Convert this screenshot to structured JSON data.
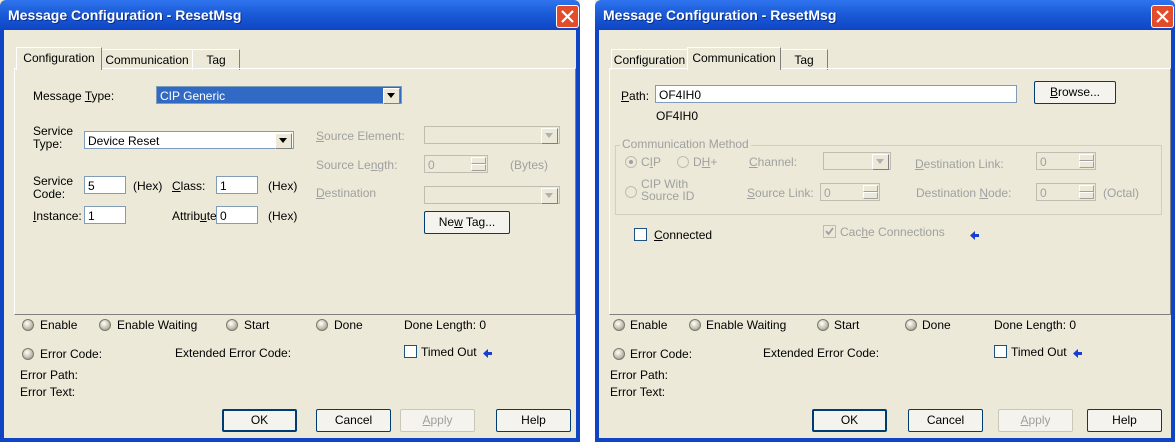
{
  "left_window": {
    "title": "Message Configuration - ResetMsg",
    "tabs": [
      "Configuration",
      "Communication",
      "Tag"
    ],
    "message_type_label": "Message Type:",
    "message_type_value": "CIP Generic",
    "service_type_label_1": "Service",
    "service_type_label_2": "Type:",
    "service_type_value": "Device Reset",
    "source_element_label": "Source Element:",
    "source_length_label": "Source Length:",
    "source_length_value": "0",
    "bytes_label": "(Bytes)",
    "destination_label": "Destination",
    "service_code_label_1": "Service",
    "service_code_label_2": "Code:",
    "service_code_value": "5",
    "hex_label_1": "(Hex)",
    "class_label": "Class:",
    "class_value": "1",
    "hex_label_2": "(Hex)",
    "instance_label": "Instance:",
    "instance_value": "1",
    "attribute_label": "Attribute:",
    "attribute_value": "0",
    "hex_label_3": "(Hex)",
    "new_tag_button": "New Tag...",
    "status": {
      "enable": "Enable",
      "enable_waiting": "Enable Waiting",
      "start": "Start",
      "done": "Done",
      "done_length": "Done Length: 0",
      "error_code": "Error Code:",
      "extended_error_code": "Extended Error Code:",
      "timed_out": "Timed Out",
      "error_path": "Error Path:",
      "error_text": "Error Text:"
    },
    "buttons": {
      "ok": "OK",
      "cancel": "Cancel",
      "apply": "Apply",
      "help": "Help"
    }
  },
  "right_window": {
    "title": "Message Configuration - ResetMsg",
    "tabs": [
      "Configuration",
      "Communication",
      "Tag"
    ],
    "path_label": "Path:",
    "path_value": "OF4IH0",
    "path_resolved": "OF4IH0",
    "browse_button": "Browse...",
    "comm_method_title": "Communication Method",
    "cip_label": "CIP",
    "dh_label": "DH+",
    "channel_label": "Channel:",
    "destination_link_label": "Destination Link:",
    "destination_link_value": "0",
    "cip_with_1": "CIP With",
    "cip_with_2": "Source ID",
    "source_link_label": "Source Link:",
    "source_link_value": "0",
    "destination_node_label": "Destination Node:",
    "destination_node_value": "0",
    "octal_label": "(Octal)",
    "connected_label": "Connected",
    "cache_label": "Cache Connections",
    "status": {
      "enable": "Enable",
      "enable_waiting": "Enable Waiting",
      "start": "Start",
      "done": "Done",
      "done_length": "Done Length: 0",
      "error_code": "Error Code:",
      "extended_error_code": "Extended Error Code:",
      "timed_out": "Timed Out",
      "error_path": "Error Path:",
      "error_text": "Error Text:"
    },
    "buttons": {
      "ok": "OK",
      "cancel": "Cancel",
      "apply": "Apply",
      "help": "Help"
    }
  },
  "colors": {
    "title_bar": "#1b5bd8",
    "close_button": "#e24c2b",
    "selection": "#316ac5",
    "dialog_bg": "#ece9d8"
  },
  "icons": [
    "close-icon",
    "combo-arrow-icon",
    "spin-arrow-icon",
    "checkmark-icon",
    "blue-arrow-icon",
    "status-lamp-icon"
  ]
}
